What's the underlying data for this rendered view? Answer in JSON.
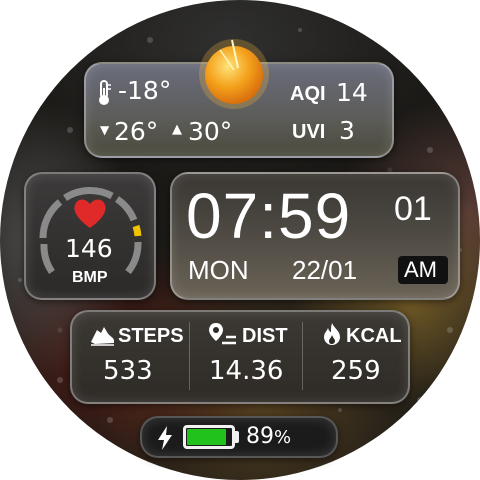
{
  "weather": {
    "current_temp": "-18°",
    "low_temp": "26°",
    "high_temp": "30°",
    "aqi_label": "AQI",
    "aqi_value": "14",
    "uvi_label": "UVI",
    "uvi_value": "3",
    "condition_icon": "sun-icon"
  },
  "heart_rate": {
    "value": "146",
    "unit": "BMP",
    "gauge_level": 0.62,
    "gauge_accent": "#f2c200"
  },
  "clock": {
    "time": "07:59",
    "seconds": "01",
    "day": "MON",
    "date": "22/01",
    "ampm": "AM"
  },
  "stats": {
    "steps_label": "STEPS",
    "steps_value": "533",
    "dist_label": "DIST",
    "dist_value": "14.36",
    "kcal_label": "KCAL",
    "kcal_value": "259"
  },
  "battery": {
    "percent_value": "89",
    "percent_sign": "%",
    "level": 0.89,
    "fill_color": "#22c21c"
  }
}
